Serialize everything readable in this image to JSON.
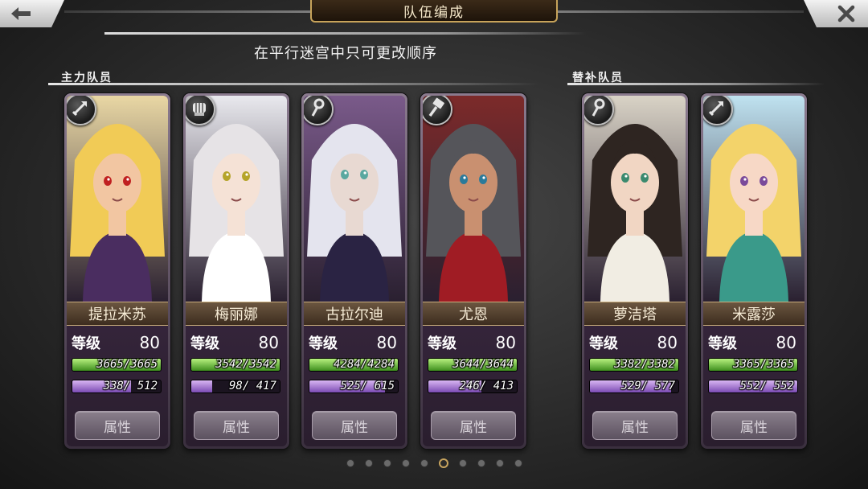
{
  "header": {
    "title": "队伍编成",
    "notice": "在平行迷宫中只可更改顺序",
    "back_icon": "back-arrow-icon",
    "close_icon": "close-icon"
  },
  "sections": {
    "main": "主力队员",
    "reserve": "替补队员"
  },
  "main_members": [
    {
      "name": "提拉米苏",
      "level_label": "等级",
      "level": "80",
      "hp_text": "3665/3665",
      "hp_ratio": 1.0,
      "mp_text": "338/ 512",
      "mp_ratio": 0.66,
      "class_icon": "arrow-icon",
      "attr_label": "属性"
    },
    {
      "name": "梅丽娜",
      "level_label": "等级",
      "level": "80",
      "hp_text": "3542/3542",
      "hp_ratio": 1.0,
      "mp_text": "98/ 417",
      "mp_ratio": 0.235,
      "class_icon": "fist-icon",
      "attr_label": "属性"
    },
    {
      "name": "古拉尔迪",
      "level_label": "等级",
      "level": "80",
      "hp_text": "4284/4284",
      "hp_ratio": 1.0,
      "mp_text": "525/ 615",
      "mp_ratio": 0.854,
      "class_icon": "staff-icon",
      "attr_label": "属性"
    },
    {
      "name": "尤恩",
      "level_label": "等级",
      "level": "80",
      "hp_text": "3644/3644",
      "hp_ratio": 1.0,
      "mp_text": "246/ 413",
      "mp_ratio": 0.596,
      "class_icon": "hammer-icon",
      "attr_label": "属性"
    }
  ],
  "reserve_members": [
    {
      "name": "萝洁塔",
      "level_label": "等级",
      "level": "80",
      "hp_text": "3382/3382",
      "hp_ratio": 1.0,
      "mp_text": "529/ 577",
      "mp_ratio": 0.917,
      "class_icon": "staff-icon",
      "attr_label": "属性"
    },
    {
      "name": "米露莎",
      "level_label": "等级",
      "level": "80",
      "hp_text": "3365/3365",
      "hp_ratio": 1.0,
      "mp_text": "552/ 552",
      "mp_ratio": 1.0,
      "class_icon": "arrow-icon",
      "attr_label": "属性"
    }
  ],
  "pager": {
    "count": 10,
    "active": 5
  }
}
